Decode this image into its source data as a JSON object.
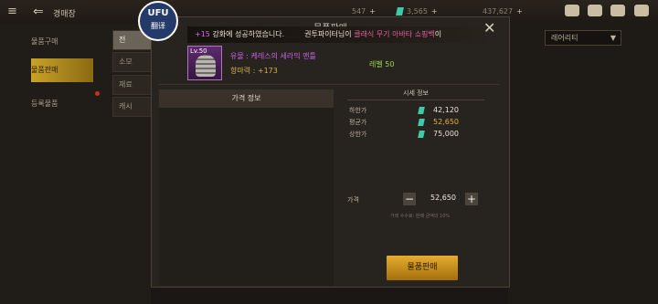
{
  "topbar": {
    "title": "경매장",
    "currency1": "547",
    "currency2": "3,565",
    "currency3": "437,627"
  },
  "leftnav": [
    "물품구매",
    "물품판매",
    "등록물품"
  ],
  "subtabs": [
    "전",
    "소모",
    "재료",
    "캐시"
  ],
  "dropdown": {
    "value": "레어리티"
  },
  "modal": {
    "title": "물품판매"
  },
  "notice": {
    "enhance": "+15",
    "text1": "강화에 성공하였습니다.",
    "text2": "권투파이터님이",
    "item": "클래식 무기 아바타 쇼핑백",
    "text3": "이"
  },
  "watermark": {
    "logo": "UFU",
    "label": "翻译"
  },
  "item": {
    "level_badge": "Lv.50",
    "name": "유물 : 케레스의 세라믹 맨틀",
    "stat": "향마력 : +173",
    "level": "레벨 50"
  },
  "price_panel": {
    "title": "가격 정보"
  },
  "market": {
    "title": "시세 정보",
    "rows": [
      {
        "label": "하한가",
        "value": "42,120"
      },
      {
        "label": "평균가",
        "value": "52,650"
      },
      {
        "label": "상한가",
        "value": "75,000"
      }
    ]
  },
  "price": {
    "label": "가격",
    "minus": "−",
    "value": "52,650",
    "plus": "+",
    "fee_note": "거래 수수료: 판매 금액의 10%"
  },
  "sell_button": "물품판매",
  "colors": {
    "accent": "#c9a227",
    "gem": "#3ec9a8",
    "epic": "#c662e0"
  }
}
